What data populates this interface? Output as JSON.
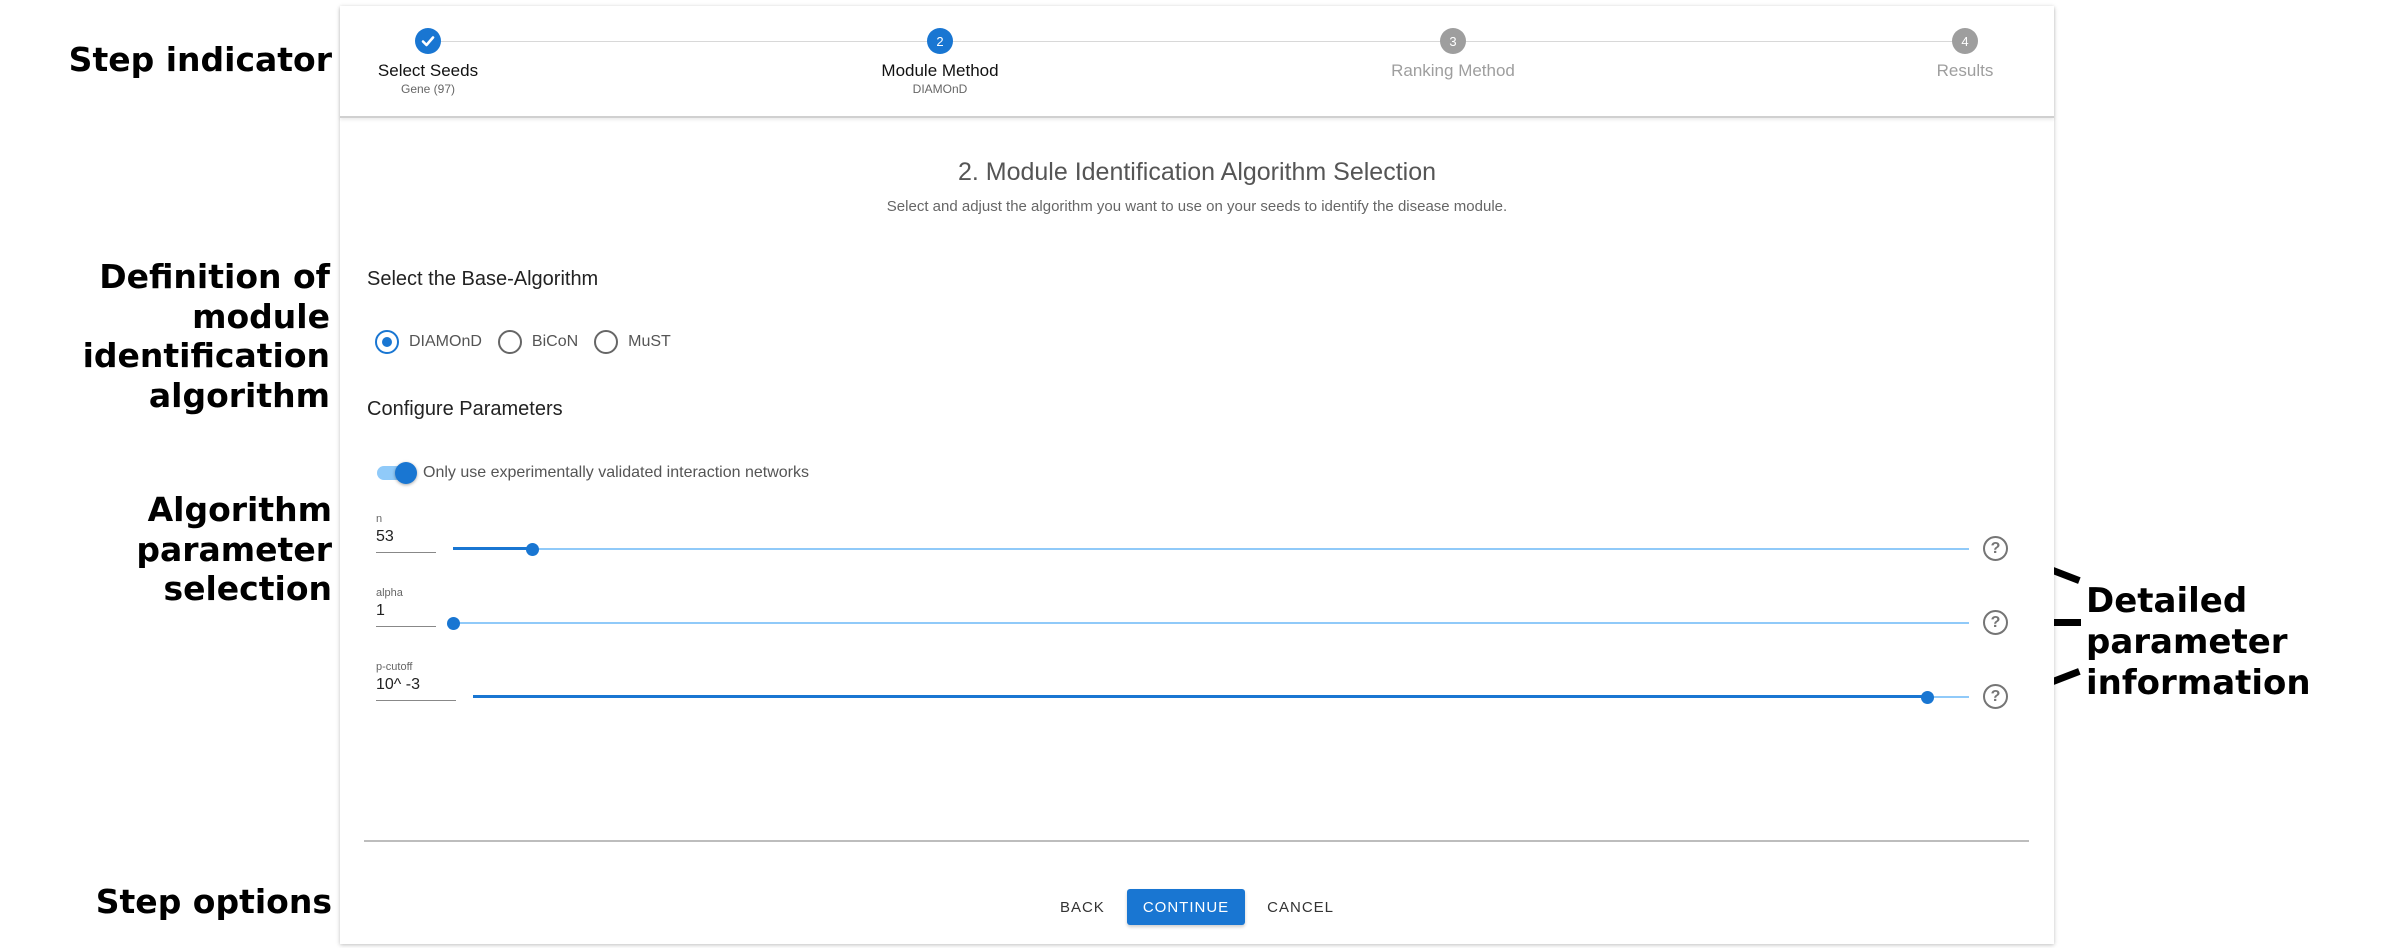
{
  "annotations": {
    "step_indicator": "Step indicator",
    "definition": [
      "Definition of module",
      "identification",
      "algorithm"
    ],
    "parameter_selection": [
      "Algorithm",
      "parameter",
      "selection"
    ],
    "detailed_info": [
      "Detailed parameter",
      "information"
    ],
    "step_options": "Step options"
  },
  "stepper": {
    "steps": [
      {
        "number": "1",
        "label": "Select Seeds",
        "sub": "Gene (97)",
        "state": "done"
      },
      {
        "number": "2",
        "label": "Module Method",
        "sub": "DIAMOnD",
        "state": "active"
      },
      {
        "number": "3",
        "label": "Ranking Method",
        "sub": "",
        "state": "inactive"
      },
      {
        "number": "4",
        "label": "Results",
        "sub": "",
        "state": "inactive"
      }
    ]
  },
  "content": {
    "title": "2. Module Identification Algorithm Selection",
    "subtitle": "Select and adjust the algorithm you want to use on your seeds to identify the disease module."
  },
  "base_algorithm": {
    "heading": "Select the Base-Algorithm",
    "options": [
      "DIAMOnD",
      "BiCoN",
      "MuST"
    ],
    "selected": "DIAMOnD"
  },
  "parameters": {
    "heading": "Configure Parameters",
    "toggle_label": "Only use experimentally validated interaction networks",
    "toggle_on": true,
    "items": [
      {
        "label": "n",
        "value": "53",
        "slider_fraction": 0.052
      },
      {
        "label": "alpha",
        "value": "1",
        "slider_fraction": 0.0
      },
      {
        "label": "p-cutoff",
        "value": "10^ -3",
        "slider_fraction": 0.972
      }
    ]
  },
  "buttons": {
    "back": "Back",
    "continue": "Continue",
    "cancel": "Cancel"
  },
  "colors": {
    "primary": "#1976d2",
    "inactive": "#9e9e9e"
  },
  "icons": {
    "check": "check-icon",
    "help": "help-circle-icon"
  }
}
